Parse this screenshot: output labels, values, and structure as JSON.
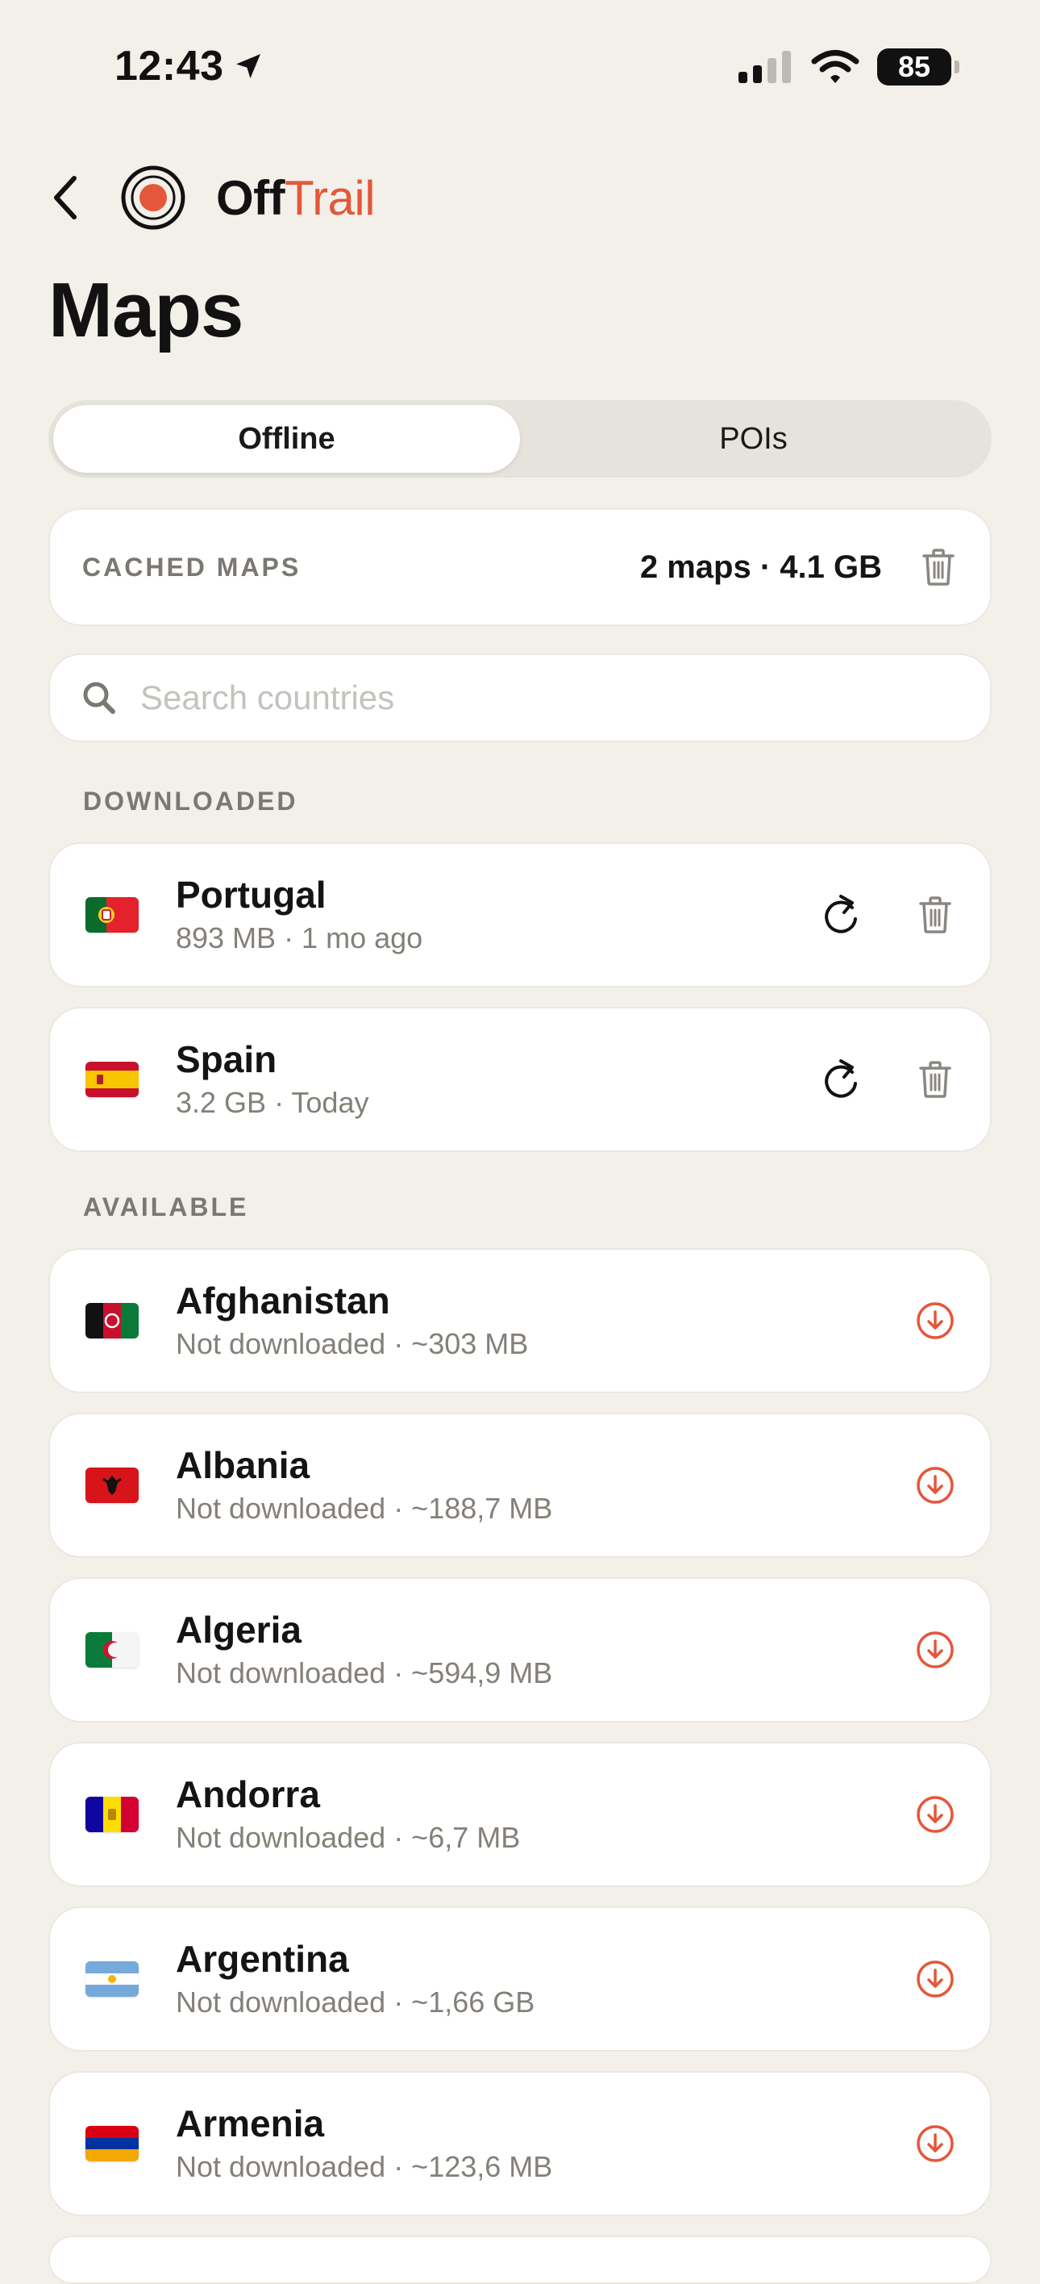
{
  "status": {
    "time": "12:43",
    "battery": "85"
  },
  "header": {
    "brand_part1": "Off",
    "brand_part2": "Trail"
  },
  "page": {
    "title": "Maps"
  },
  "tabs": [
    {
      "label": "Offline",
      "active": true
    },
    {
      "label": "POIs",
      "active": false
    }
  ],
  "cache": {
    "label": "CACHED MAPS",
    "summary": "2 maps · 4.1 GB"
  },
  "search": {
    "placeholder": "Search countries"
  },
  "sections": {
    "downloaded": "DOWNLOADED",
    "available": "AVAILABLE"
  },
  "downloaded": [
    {
      "name": "Portugal",
      "sub": "893 MB · 1 mo ago"
    },
    {
      "name": "Spain",
      "sub": "3.2 GB · Today"
    }
  ],
  "available": [
    {
      "name": "Afghanistan",
      "sub": "Not downloaded · ~303 MB"
    },
    {
      "name": "Albania",
      "sub": "Not downloaded · ~188,7 MB"
    },
    {
      "name": "Algeria",
      "sub": "Not downloaded · ~594,9 MB"
    },
    {
      "name": "Andorra",
      "sub": "Not downloaded · ~6,7 MB"
    },
    {
      "name": "Argentina",
      "sub": "Not downloaded · ~1,66 GB"
    },
    {
      "name": "Armenia",
      "sub": "Not downloaded · ~123,6 MB"
    }
  ],
  "colors": {
    "accent": "#e4573a",
    "background": "#f3f0ea",
    "muted": "#848079"
  },
  "icons": {
    "location": "location-arrow-icon",
    "back": "chevron-left-icon",
    "refresh": "refresh-icon",
    "trash": "trash-icon",
    "download": "download-circle-icon",
    "search": "search-icon"
  }
}
